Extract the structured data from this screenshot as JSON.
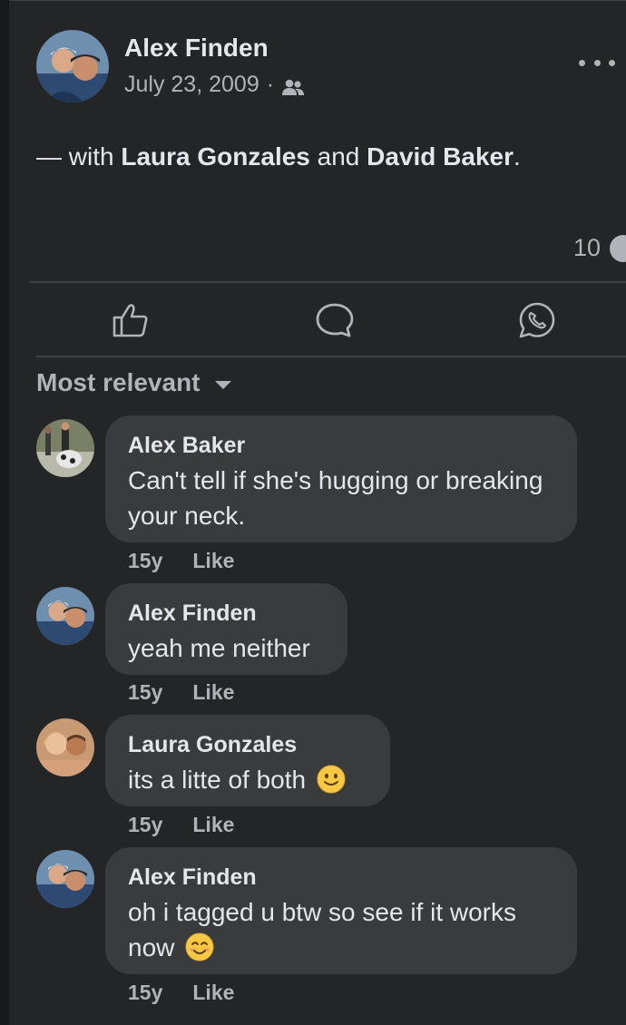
{
  "post": {
    "author": "Alex Finden",
    "date": "July 23, 2009",
    "separator": "·",
    "audience_icon": "friends-icon",
    "more_icon": "more-options-icon",
    "text": {
      "prefix": "— with",
      "tag1": "Laura Gonzales",
      "middle": "and",
      "tag2": "David Baker",
      "suffix": "."
    },
    "reaction_count": "10"
  },
  "actions": {
    "like_icon": "thumbs-up-icon",
    "comment_icon": "comment-icon",
    "share_icon": "whatsapp-icon"
  },
  "comments_sort": {
    "label": "Most relevant",
    "icon": "caret-down-icon"
  },
  "comments": [
    {
      "author": "Alex Baker",
      "text": "Can't tell if she's hugging or breaking your neck.",
      "time": "15y",
      "like": "Like"
    },
    {
      "author": "Alex Finden",
      "text": "yeah me neither",
      "time": "15y",
      "like": "Like"
    },
    {
      "author": "Laura Gonzales",
      "text": "its a litte of both",
      "emoji": "🙂",
      "time": "15y",
      "like": "Like"
    },
    {
      "author": "Alex Finden",
      "text": "oh i tagged u btw so see if it works now",
      "emoji": "😊",
      "time": "15y",
      "like": "Like"
    }
  ],
  "colors": {
    "background": "#242526",
    "bubble": "#3a3b3c",
    "primary_text": "#e4e6eb",
    "secondary_text": "#b0b3b8",
    "divider": "#3e4042"
  }
}
